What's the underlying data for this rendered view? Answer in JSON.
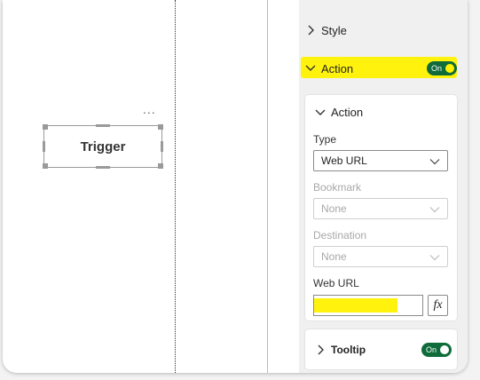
{
  "canvas": {
    "visual_menu": "...",
    "button_label": "Trigger"
  },
  "pane": {
    "style_section": {
      "label": "Style",
      "icon": "chevron-right-icon"
    },
    "action_section": {
      "label": "Action",
      "toggle_label": "On",
      "expanded": true,
      "icon": "chevron-down-icon"
    },
    "action_card": {
      "title": "Action",
      "type": {
        "label": "Type",
        "value": "Web URL",
        "enabled": true
      },
      "bookmark": {
        "label": "Bookmark",
        "value": "None",
        "enabled": false
      },
      "destination": {
        "label": "Destination",
        "value": "None",
        "enabled": false
      },
      "web_url": {
        "label": "Web URL",
        "value": "",
        "fx_label": "fx"
      }
    },
    "tooltip_section": {
      "label": "Tooltip",
      "toggle_label": "On",
      "icon": "chevron-right-icon"
    }
  },
  "colors": {
    "highlight": "#fff200",
    "toggle_on": "#0f6b3a",
    "disabled_text": "#a8a8a8"
  }
}
